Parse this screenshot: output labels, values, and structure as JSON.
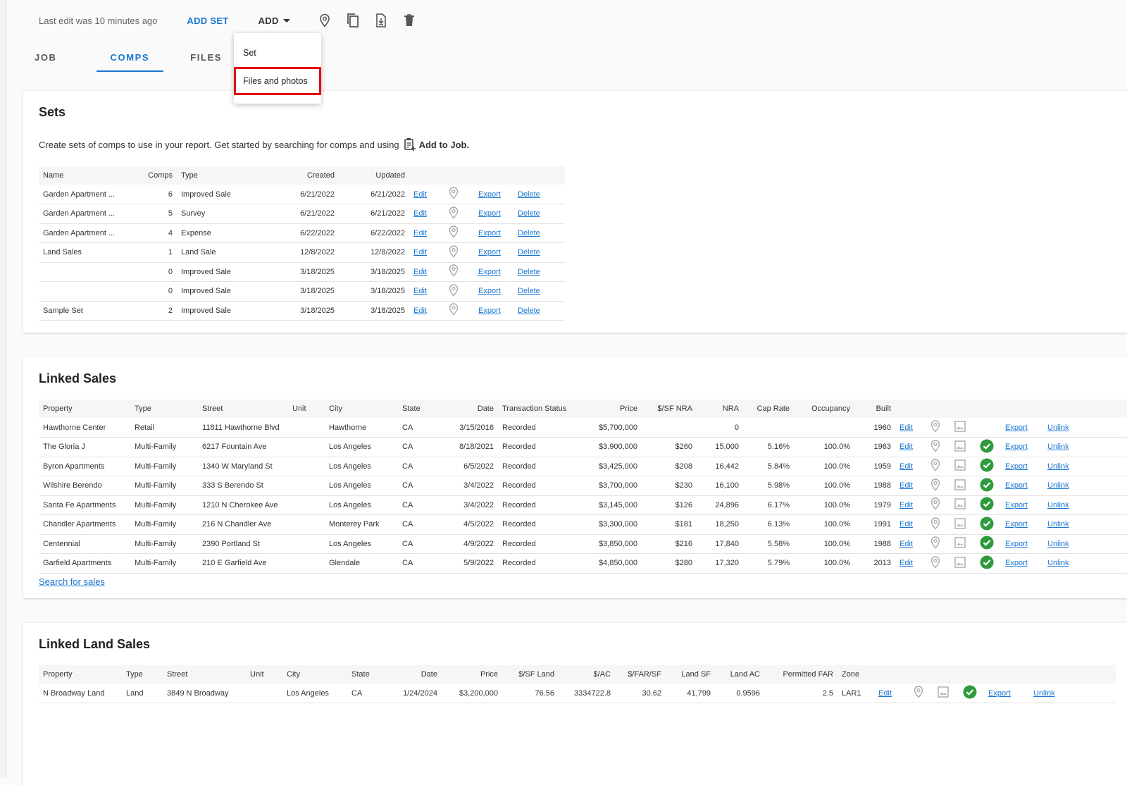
{
  "toolbar": {
    "last_edit": "Last edit was 10 minutes ago",
    "add_set_label": "ADD SET",
    "add_label": "ADD",
    "icons": [
      "map-pin-icon",
      "copy-icon",
      "file-download-icon",
      "trash-icon"
    ]
  },
  "tabs": [
    {
      "label": "JOB",
      "active": false
    },
    {
      "label": "COMPS",
      "active": true
    },
    {
      "label": "FILES",
      "active": false
    }
  ],
  "add_menu": {
    "items": [
      {
        "label": "Set",
        "highlighted": false
      },
      {
        "label": "Files and photos",
        "highlighted": true
      }
    ]
  },
  "colors": {
    "accent": "#1976d2",
    "highlight": "#e3000f",
    "success": "#2e9b3c"
  },
  "sets": {
    "title": "Sets",
    "description_prefix": "Create sets of comps to use in your report. Get started by searching for comps and using",
    "description_action": "Add to Job.",
    "columns": [
      "Name",
      "Comps",
      "Type",
      "Created",
      "Updated"
    ],
    "rows": [
      {
        "name": "Garden Apartment ...",
        "comps": "6",
        "type": "Improved Sale",
        "created": "6/21/2022",
        "updated": "6/21/2022"
      },
      {
        "name": "Garden Apartment ...",
        "comps": "5",
        "type": "Survey",
        "created": "6/21/2022",
        "updated": "6/21/2022"
      },
      {
        "name": "Garden Apartment ...",
        "comps": "4",
        "type": "Expense",
        "created": "6/22/2022",
        "updated": "6/22/2022"
      },
      {
        "name": "Land Sales",
        "comps": "1",
        "type": "Land Sale",
        "created": "12/8/2022",
        "updated": "12/8/2022"
      },
      {
        "name": "",
        "comps": "0",
        "type": "Improved Sale",
        "created": "3/18/2025",
        "updated": "3/18/2025"
      },
      {
        "name": "",
        "comps": "0",
        "type": "Improved Sale",
        "created": "3/18/2025",
        "updated": "3/18/2025"
      },
      {
        "name": "Sample Set",
        "comps": "2",
        "type": "Improved Sale",
        "created": "3/18/2025",
        "updated": "3/18/2025"
      }
    ],
    "edit_label": "Edit",
    "export_label": "Export",
    "delete_label": "Delete"
  },
  "linked_sales": {
    "title": "Linked Sales",
    "columns": [
      "Property",
      "Type",
      "Street",
      "Unit",
      "City",
      "State",
      "Date",
      "Transaction Status",
      "Price",
      "$/SF NRA",
      "NRA",
      "Cap Rate",
      "Occupancy",
      "Built"
    ],
    "rows": [
      {
        "property": "Hawthorne Center",
        "type": "Retail",
        "street": "11811 Hawthorne Blvd",
        "unit": "",
        "city": "Hawthorne",
        "state": "CA",
        "date": "3/15/2016",
        "status": "Recorded",
        "price": "$5,700,000",
        "psf": "",
        "nra": "0",
        "cap": "",
        "occ": "",
        "built": "1960",
        "verified": false
      },
      {
        "property": "The Gloria J",
        "type": "Multi-Family",
        "street": "6217 Fountain Ave",
        "unit": "",
        "city": "Los Angeles",
        "state": "CA",
        "date": "8/18/2021",
        "status": "Recorded",
        "price": "$3,900,000",
        "psf": "$260",
        "nra": "15,000",
        "cap": "5.16%",
        "occ": "100.0%",
        "built": "1963",
        "verified": true
      },
      {
        "property": "Byron Apartments",
        "type": "Multi-Family",
        "street": "1340 W Maryland St",
        "unit": "",
        "city": "Los Angeles",
        "state": "CA",
        "date": "6/5/2022",
        "status": "Recorded",
        "price": "$3,425,000",
        "psf": "$208",
        "nra": "16,442",
        "cap": "5.84%",
        "occ": "100.0%",
        "built": "1959",
        "verified": true
      },
      {
        "property": "Wilshire Berendo",
        "type": "Multi-Family",
        "street": "333 S Berendo St",
        "unit": "",
        "city": "Los Angeles",
        "state": "CA",
        "date": "3/4/2022",
        "status": "Recorded",
        "price": "$3,700,000",
        "psf": "$230",
        "nra": "16,100",
        "cap": "5.98%",
        "occ": "100.0%",
        "built": "1988",
        "verified": true
      },
      {
        "property": "Santa Fe Apartments",
        "type": "Multi-Family",
        "street": "1210 N Cherokee Ave",
        "unit": "",
        "city": "Los Angeles",
        "state": "CA",
        "date": "3/4/2022",
        "status": "Recorded",
        "price": "$3,145,000",
        "psf": "$126",
        "nra": "24,896",
        "cap": "6.17%",
        "occ": "100.0%",
        "built": "1979",
        "verified": true
      },
      {
        "property": "Chandler Apartments",
        "type": "Multi-Family",
        "street": "216 N Chandler Ave",
        "unit": "",
        "city": "Monterey Park",
        "state": "CA",
        "date": "4/5/2022",
        "status": "Recorded",
        "price": "$3,300,000",
        "psf": "$181",
        "nra": "18,250",
        "cap": "6.13%",
        "occ": "100.0%",
        "built": "1991",
        "verified": true
      },
      {
        "property": "Centennial",
        "type": "Multi-Family",
        "street": "2390 Portland St",
        "unit": "",
        "city": "Los Angeles",
        "state": "CA",
        "date": "4/9/2022",
        "status": "Recorded",
        "price": "$3,850,000",
        "psf": "$216",
        "nra": "17,840",
        "cap": "5.58%",
        "occ": "100.0%",
        "built": "1988",
        "verified": true
      },
      {
        "property": "Garfield Apartments",
        "type": "Multi-Family",
        "street": "210 E Garfield Ave",
        "unit": "",
        "city": "Glendale",
        "state": "CA",
        "date": "5/9/2022",
        "status": "Recorded",
        "price": "$4,850,000",
        "psf": "$280",
        "nra": "17,320",
        "cap": "5.79%",
        "occ": "100.0%",
        "built": "2013",
        "verified": true
      }
    ],
    "edit_label": "Edit",
    "export_label": "Export",
    "unlink_label": "Unlink",
    "search_link": "Search for sales"
  },
  "linked_land_sales": {
    "title": "Linked Land Sales",
    "columns": [
      "Property",
      "Type",
      "Street",
      "Unit",
      "City",
      "State",
      "Date",
      "Price",
      "$/SF Land",
      "$/AC",
      "$/FAR/SF",
      "Land SF",
      "Land AC",
      "Permitted FAR",
      "Zone"
    ],
    "rows": [
      {
        "property": "N Broadway Land",
        "type": "Land",
        "street": "3849 N Broadway",
        "unit": "",
        "city": "Los Angeles",
        "state": "CA",
        "date": "1/24/2024",
        "price": "$3,200,000",
        "psf_land": "76.56",
        "per_ac": "3334722.8",
        "far_sf": "30.62",
        "land_sf": "41,799",
        "land_ac": "0.9596",
        "far": "2.5",
        "zone": "LAR1",
        "verified": true
      }
    ],
    "edit_label": "Edit",
    "export_label": "Export",
    "unlink_label": "Unlink"
  }
}
